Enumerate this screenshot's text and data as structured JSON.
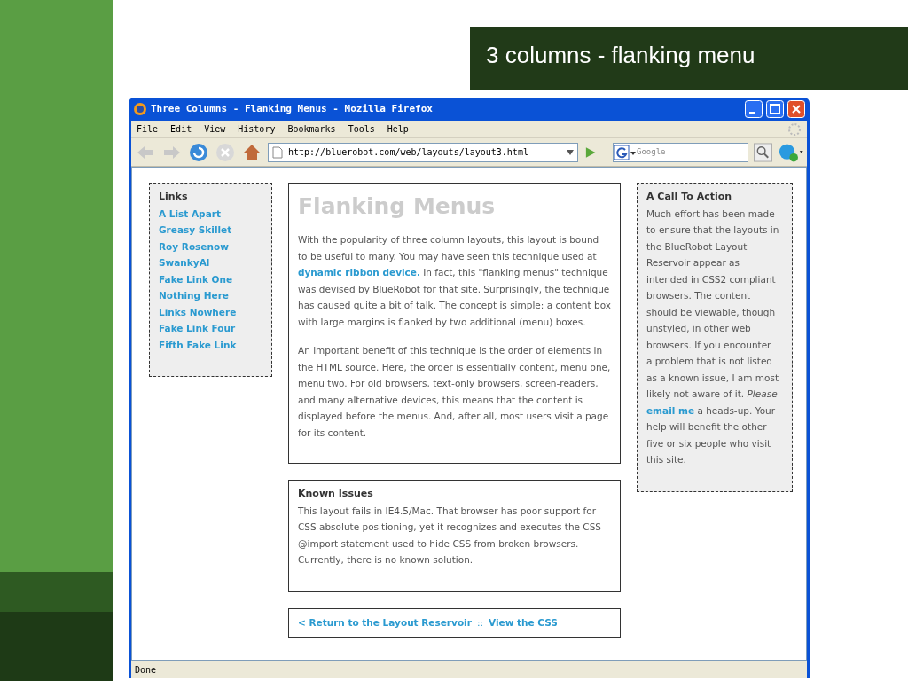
{
  "slide": {
    "title": "3 columns - flanking menu"
  },
  "window": {
    "title": "Three Columns - Flanking Menus - Mozilla Firefox"
  },
  "menu": [
    "File",
    "Edit",
    "View",
    "History",
    "Bookmarks",
    "Tools",
    "Help"
  ],
  "toolbar": {
    "url": "http://bluerobot.com/web/layouts/layout3.html",
    "search_placeholder": "Google"
  },
  "left_menu": {
    "heading": "Links",
    "links": [
      "A List Apart",
      "Greasy Skillet",
      "Roy Rosenow",
      "SwankyAl",
      "Fake Link One",
      "Nothing Here",
      "Links Nowhere",
      "Fake Link Four",
      "Fifth Fake Link"
    ]
  },
  "content": {
    "title": "Flanking Menus",
    "paragraphs": [
      [
        {
          "kind": "text",
          "text": "With the popularity of three column layouts, this layout is bound to be useful to many. You may have seen this technique used at "
        },
        {
          "kind": "link",
          "text": "dynamic ribbon device."
        },
        {
          "kind": "text",
          "text": " In fact, this \"flanking menus\" technique was devised by BlueRobot for that site. Surprisingly, the technique has caused quite a bit of talk. The concept is simple: a content box with large margins is flanked by two additional (menu) boxes."
        }
      ],
      [
        {
          "kind": "text",
          "text": "An important benefit of this technique is the order of elements in the HTML source. Here, the order is essentially content, menu one, menu two. For old browsers, text-only browsers, screen-readers, and many alternative devices, this means that the content is displayed before the menus. And, after all, most users visit a page for its content."
        }
      ]
    ]
  },
  "known_issues": {
    "heading": "Known Issues",
    "text": "This layout fails in IE4.5/Mac. That browser has poor support for CSS absolute positioning, yet it recognizes and executes the CSS @import statement used to hide CSS from broken browsers. Currently, there is no known solution."
  },
  "footer_links": [
    {
      "kind": "link",
      "text": "< Return to the Layout Reservoir"
    },
    {
      "kind": "separator",
      "text": "::"
    },
    {
      "kind": "link",
      "text": "View the CSS"
    }
  ],
  "right_menu": {
    "heading": "A Call To Action",
    "segments": [
      {
        "kind": "text",
        "text": "Much effort has been made to ensure that the layouts in the BlueRobot Layout Reservoir appear as intended in CSS2 compliant browsers. The content should be viewable, though unstyled, in other web browsers. If you encounter a problem that is not listed as a known issue, I am most likely not aware of it. *Please* "
      },
      {
        "kind": "link",
        "text": "email me"
      },
      {
        "kind": "text",
        "text": " a heads-up. Your help will benefit the other five or six people who visit this site."
      }
    ]
  },
  "status_bar": "Done"
}
